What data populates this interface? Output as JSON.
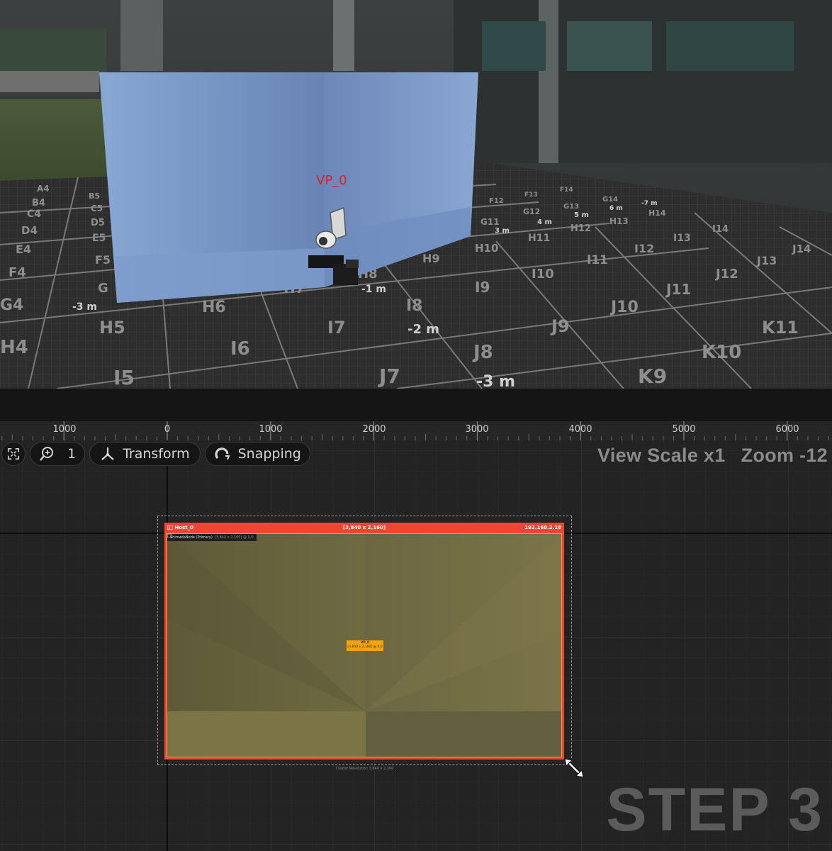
{
  "viewport_3d": {
    "viewport_label": "VP_0",
    "grid_labels": [
      "A4",
      "B4",
      "C4",
      "D4",
      "E4",
      "F4",
      "G4",
      "H5",
      "H6",
      "H7",
      "H8",
      "H9",
      "H10",
      "H11",
      "H12",
      "H13",
      "H14",
      "I5",
      "I6",
      "I7",
      "I8",
      "I9",
      "I10",
      "I11",
      "I12",
      "I13",
      "I14",
      "J7",
      "J8",
      "J9",
      "J10",
      "J11",
      "J12",
      "J13",
      "J14",
      "K9",
      "K10",
      "K11",
      "G11",
      "G12",
      "G13",
      "G14",
      "F12",
      "F13",
      "F14",
      "B5",
      "C5",
      "D5",
      "E5",
      "F5",
      "G"
    ],
    "distance_labels": [
      "-3 m",
      "-1 m",
      "-2 m",
      "-3 m",
      "3 m",
      "4 m",
      "5 m",
      "6 m",
      "-7 m"
    ]
  },
  "ruler": {
    "ticks": [
      "1000",
      "0",
      "1000",
      "2000",
      "3000",
      "4000",
      "5000",
      "6000"
    ]
  },
  "toolbar": {
    "zoom_value": "1",
    "transform_label": "Transform",
    "snapping_label": "Snapping"
  },
  "view_info": {
    "scale": "View Scale x1",
    "zoom": "Zoom -12"
  },
  "host": {
    "name": "Host_0",
    "resolution": "[3,840 x 2,160]",
    "ip": "192.168.2.18"
  },
  "node": {
    "name": "ShimadaNode (Primary)",
    "detail": "[3,840 x 2,160] @ 0,0"
  },
  "viewport_badge": {
    "name": "VP_0",
    "detail": "[3,840 x 2,160] @ 0,0"
  },
  "cluster_resolution": "Cluster Resolution 3,840 x 2,160",
  "step_label": "STEP 3",
  "colors": {
    "host_frame": "#f24431",
    "viewport_badge": "#f2a30f",
    "node_border": "#e8a53d",
    "vp_label_3d": "#e02020"
  },
  "icons": {
    "fit": "fit-view-icon",
    "zoom": "zoom-icon",
    "transform": "transform-gizmo-icon",
    "snapping": "magnet-icon",
    "resize": "resize-diagonal-icon",
    "camera": "camera-icon"
  }
}
